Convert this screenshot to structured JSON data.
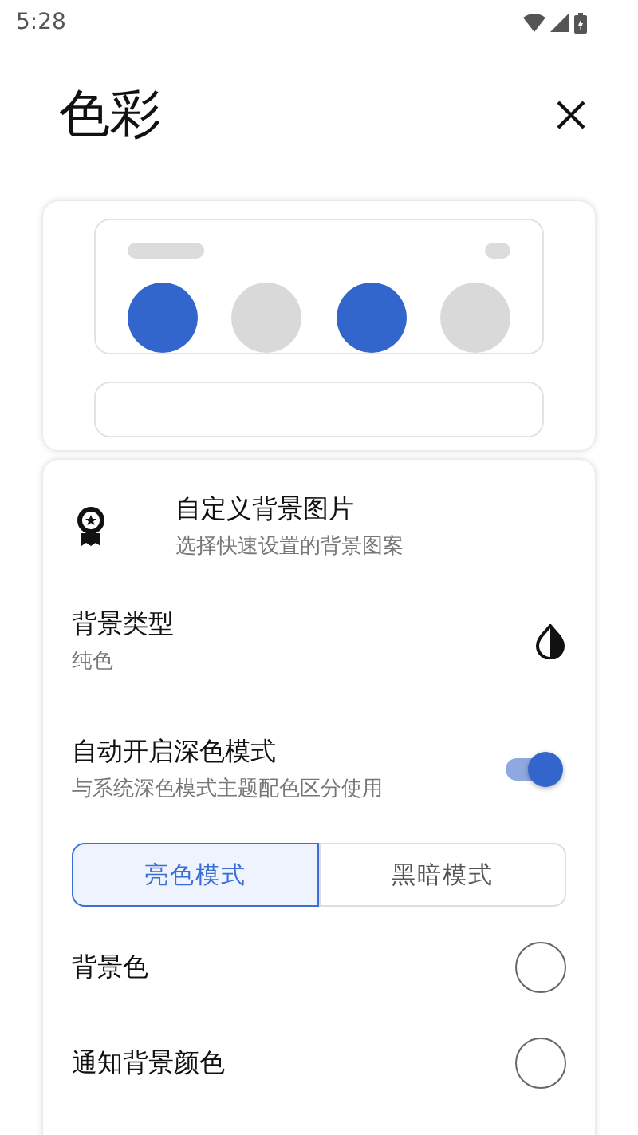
{
  "status_bar": {
    "time": "5:28"
  },
  "title": "色彩",
  "preview": {
    "swatches": [
      {
        "color": "#3366cc"
      },
      {
        "color": "#d9d9d9"
      },
      {
        "color": "#3366cc"
      },
      {
        "color": "#d9d9d9"
      }
    ]
  },
  "settings": [
    {
      "kind": "badge",
      "title": "自定义背景图片",
      "subtitle": "选择快速设置的背景图案"
    },
    {
      "kind": "contrast",
      "title": "背景类型",
      "subtitle": "纯色"
    },
    {
      "kind": "switch",
      "title": "自动开启深色模式",
      "subtitle": "与系统深色模式主题配色区分使用",
      "on": true
    },
    {
      "kind": "segments",
      "segments": [
        {
          "label": "亮色模式",
          "selected": true
        },
        {
          "label": "黑暗模式",
          "selected": false
        }
      ]
    },
    {
      "kind": "color",
      "title": "背景色",
      "color": "#ffffff"
    },
    {
      "kind": "color",
      "title": "通知背景颜色",
      "color": "#ffffff"
    }
  ]
}
